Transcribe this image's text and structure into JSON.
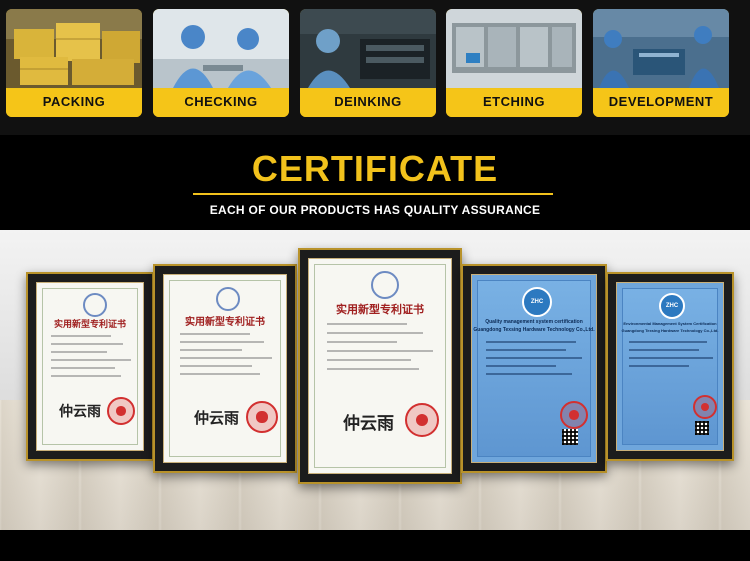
{
  "process_steps": [
    {
      "label": "PACKING"
    },
    {
      "label": "CHECKING"
    },
    {
      "label": "DEINKING"
    },
    {
      "label": "ETCHING"
    },
    {
      "label": "DEVELOPMENT"
    }
  ],
  "certificate": {
    "title": "CERTIFICATE",
    "subtitle": "EACH OF OUR PRODUCTS HAS QUALITY ASSURANCE"
  },
  "certificates": [
    {
      "type": "patent",
      "title": "实用新型专利证书"
    },
    {
      "type": "patent",
      "title": "实用新型专利证书"
    },
    {
      "type": "patent",
      "title": "实用新型专利证书"
    },
    {
      "type": "quality",
      "logo": "ZHC",
      "title": "Quality management system certification",
      "company": "Guangdong Texsing Hardware Technology Co.,Ltd."
    },
    {
      "type": "environment",
      "logo": "ZHC",
      "title": "Environmental Management System Certification",
      "company": "Guangdong Texsing Hardware Technology Co.,Ltd."
    }
  ],
  "colors": {
    "accent": "#f2c21c",
    "background": "#000000"
  }
}
